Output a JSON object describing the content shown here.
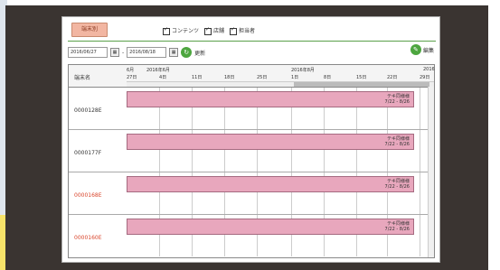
{
  "header": {
    "term_label": "端末別",
    "filters": [
      "コンテンツ",
      "店舗",
      "担当者"
    ]
  },
  "dates": {
    "start": "2016/06/27",
    "end": "2016/08/18",
    "update_label": "更新",
    "right_label": "編集"
  },
  "table": {
    "name_header": "端末名",
    "months": [
      "6月",
      "2016年6月",
      "2016年8月",
      "2016"
    ],
    "days": [
      "27日",
      "4日",
      "11日",
      "18日",
      "25日",
      "1日",
      "8日",
      "15日",
      "22日",
      "29日"
    ]
  },
  "rows": [
    {
      "name": "0000128E",
      "bar_title": "テキ同様様",
      "bar_range": "7/22 - 8/26"
    },
    {
      "name": "0000177F",
      "bar_title": "テキ同様様",
      "bar_range": "7/22 - 8/26"
    },
    {
      "name": "0000168E",
      "bar_title": "テキ同様様",
      "bar_range": "7/22 - 8/26"
    },
    {
      "name": "0000160E",
      "bar_title": "テキ同様様",
      "bar_range": "7/22 - 8/26"
    }
  ],
  "colors": {
    "accent": "#e8a7bd",
    "button": "#f2b6a2",
    "green": "#4da63f",
    "alert_name": "#d9452b"
  }
}
